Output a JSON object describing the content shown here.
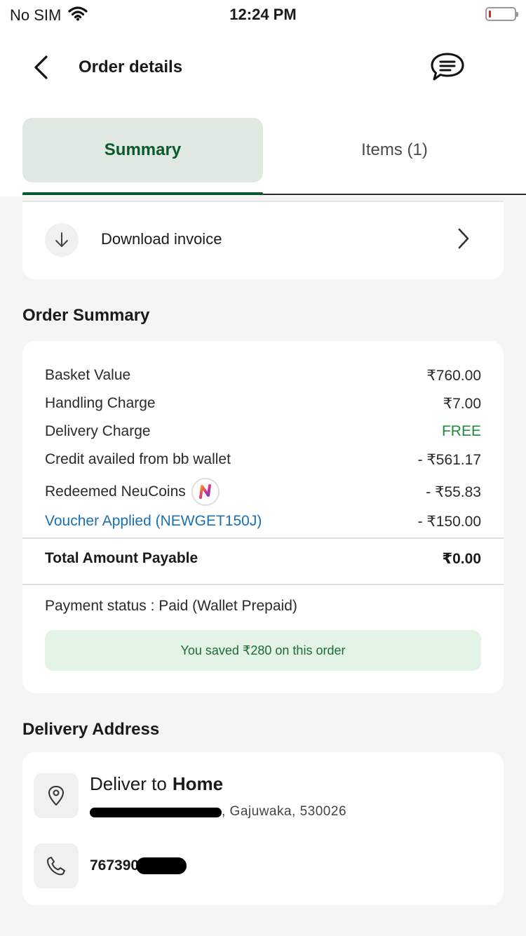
{
  "status_bar": {
    "carrier": "No SIM",
    "time": "12:24 PM"
  },
  "header": {
    "title": "Order details"
  },
  "tabs": [
    {
      "label": "Summary",
      "active": true
    },
    {
      "label": "Items (1)",
      "active": false
    }
  ],
  "invoice": {
    "label": "Download invoice"
  },
  "order_summary": {
    "title": "Order Summary",
    "rows": [
      {
        "label": "Basket Value",
        "value": "₹760.00"
      },
      {
        "label": "Handling Charge",
        "value": "₹7.00"
      },
      {
        "label": "Delivery Charge",
        "value": "FREE"
      },
      {
        "label": "Credit availed from bb wallet",
        "value": "- ₹561.17"
      },
      {
        "label": "Redeemed NeuCoins",
        "value": "- ₹55.83"
      },
      {
        "label": "Voucher Applied (NEWGET150J)",
        "value": "- ₹150.00"
      }
    ],
    "total_label": "Total Amount Payable",
    "total_value": "₹0.00",
    "payment_status": "Payment status : Paid (Wallet Prepaid)",
    "savings_text": "You saved ₹280 on this order"
  },
  "delivery_address": {
    "title": "Delivery Address",
    "deliver_to_prefix": "Deliver to",
    "deliver_to_name": "Home",
    "address_visible": ", Gajuwaka, 530026",
    "phone_visible": "767390"
  },
  "colors": {
    "brand_green": "#0a5a2b",
    "active_tab_bg": "#dfe9e1",
    "free_green": "#1e8a3c",
    "voucher_blue": "#1b6fb3",
    "savings_bg": "#e3f3e6"
  },
  "icons": {
    "back": "chevron-left-icon",
    "chat": "chat-bubble-icon",
    "download": "arrow-down-icon",
    "chevron": "chevron-right-icon",
    "neucoin": "neucoin-icon",
    "location": "location-pin-icon",
    "phone": "phone-icon",
    "wifi": "wifi-icon",
    "battery": "battery-icon"
  }
}
